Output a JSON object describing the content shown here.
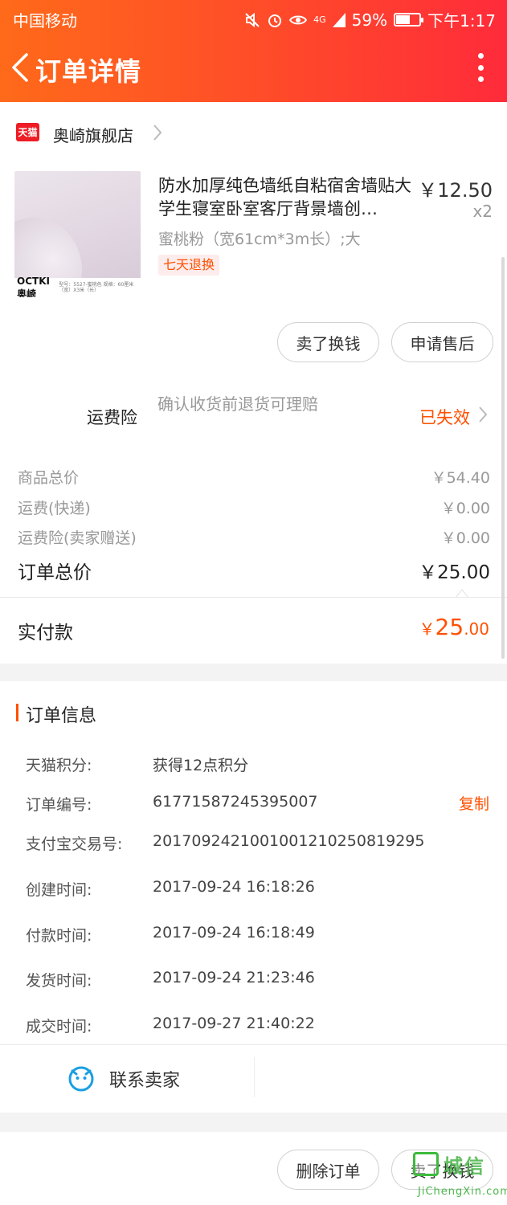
{
  "status_bar": {
    "carrier": "中国移动",
    "network": "4G",
    "battery_text": "59%",
    "battery_level": 0.59,
    "time": "下午1:17"
  },
  "nav": {
    "title": "订单详情"
  },
  "shop": {
    "badge": "天猫",
    "name": "奥崎旗舰店"
  },
  "product": {
    "title": "防水加厚纯色墙纸自粘宿舍墙贴大学生寝室卧室客厅背景墙创…",
    "price": "￥12.50",
    "quantity": "x2",
    "sku": "蜜桃粉（宽61cm*3m长）;大",
    "tag": "七天退换",
    "image_brand": "OCTKI奥崎",
    "image_spec": "型号：5527-蜜桃色 规格：60厘米（宽）X3米（长）"
  },
  "product_actions": {
    "sell": "卖了换钱",
    "after_sale": "申请售后"
  },
  "insurance": {
    "label": "运费险",
    "desc": "确认收货前退货可理赔",
    "status": "已失效"
  },
  "summary": {
    "goods_label": "商品总价",
    "goods_value": "￥54.40",
    "shipping_label": "运费(快递)",
    "shipping_value": "￥0.00",
    "insurance_label": "运费险(卖家赠送)",
    "insurance_value": "￥0.00",
    "total_label": "订单总价",
    "total_value": "￥25.00",
    "paid_label": "实付款",
    "paid_symbol": "￥",
    "paid_int": "25",
    "paid_dec": ".00"
  },
  "order_info": {
    "title": "订单信息",
    "rows": [
      {
        "label": "天猫积分:",
        "value": "获得12点积分"
      },
      {
        "label": "订单编号:",
        "value": "61771587245395007"
      },
      {
        "label": "支付宝交易号:",
        "value": "2017092421001001210250819295"
      },
      {
        "label": "创建时间:",
        "value": "2017-09-24 16:18:26"
      },
      {
        "label": "付款时间:",
        "value": "2017-09-24 16:18:49"
      },
      {
        "label": "发货时间:",
        "value": "2017-09-24 21:23:46"
      },
      {
        "label": "成交时间:",
        "value": "2017-09-27 21:40:22"
      }
    ],
    "copy": "复制"
  },
  "contact": {
    "label": "联系卖家"
  },
  "bottom_actions": {
    "delete": "删除订单",
    "sell": "卖了换钱"
  },
  "watermark": {
    "text": "城信",
    "url": "JiChengXin.com"
  },
  "colors": {
    "accent": "#ff5000",
    "header_start": "#ff6a1a",
    "header_end": "#ff2b3a",
    "tmall_red": "#ee1c25",
    "watermark_green": "#3dbb3d"
  }
}
